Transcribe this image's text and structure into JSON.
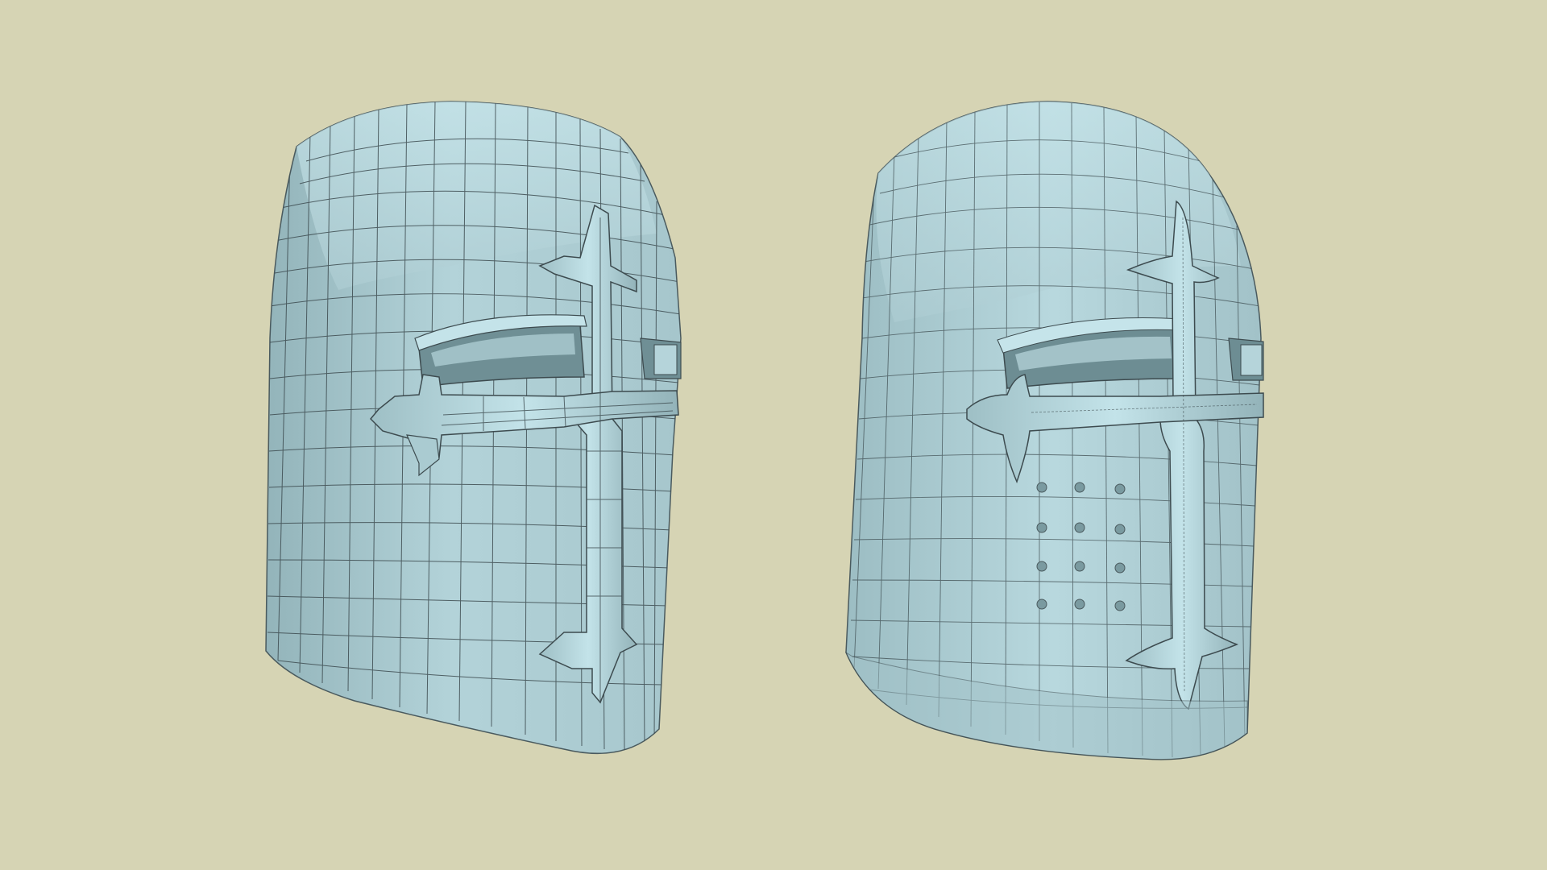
{
  "scene": {
    "background_color": "#d6d4b4",
    "mesh_color": "#a9c9cf",
    "mesh_highlight": "#c9eaf0",
    "mesh_shadow": "#8fb0b6",
    "wire_color": "#3d4b4f"
  },
  "models": [
    {
      "name": "low-poly-great-helm",
      "description_visible": false,
      "breathing_holes": 0
    },
    {
      "name": "subdivided-great-helm",
      "description_visible": false,
      "breathing_holes": 12
    }
  ]
}
